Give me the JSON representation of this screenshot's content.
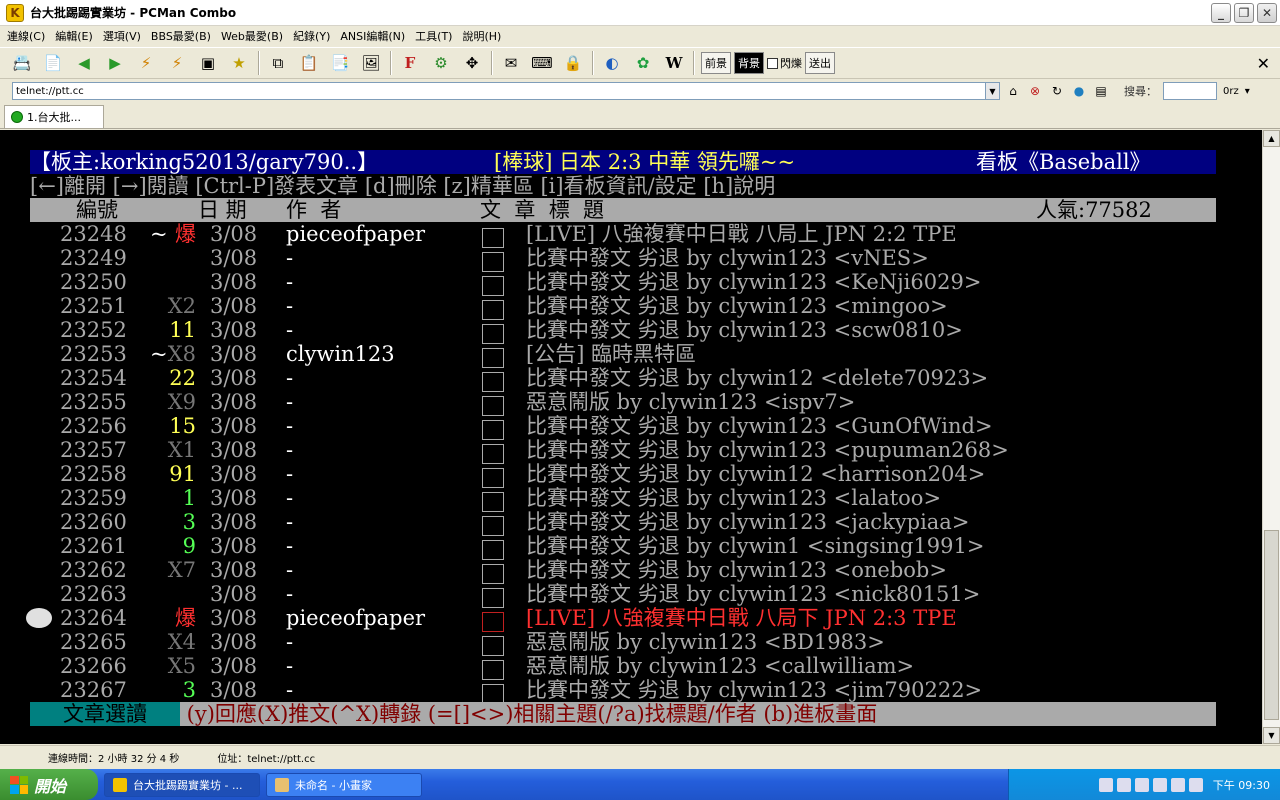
{
  "window": {
    "title": "台大批踢踢實業坊 - PCMan Combo",
    "app_icon": "K"
  },
  "menu": [
    "連線(C)",
    "編輯(E)",
    "選項(V)",
    "BBS最愛(B)",
    "Web最愛(B)",
    "紀錄(Y)",
    "ANSI編輯(N)",
    "工具(T)",
    "說明(H)"
  ],
  "toolbar": {
    "foreground_label": "前景",
    "background_label": "背景",
    "blink_label": "閃爍",
    "send_label": "送出"
  },
  "address": {
    "value": "telnet://ptt.cc",
    "search_label": "搜尋：",
    "search_mode": "0rz"
  },
  "tab": {
    "label": "1.台大批..."
  },
  "board": {
    "header_left": "【板主:korking52013/gary790..】",
    "header_mid": "[棒球] 日本 2:3 中華 領先囉~~",
    "header_right": "看板《Baseball》",
    "help_line": "[←]離開 [→]閱讀 [Ctrl-P]發表文章 [d]刪除 [z]精華區 [i]看板資訊/設定 [h]說明",
    "col_no": "編號",
    "col_date": "日 期",
    "col_author": "作  者",
    "col_title": "文  章  標  題",
    "popularity": "人氣:77582"
  },
  "posts": [
    {
      "no": "23248",
      "mark": "~",
      "score": "爆",
      "score_color": "red",
      "date": "3/08",
      "author": "pieceofpaper",
      "title": "[LIVE] 八強複賽中日戰 八局上 JPN 2:2 TPE",
      "title_color": "gray"
    },
    {
      "no": "23249",
      "mark": "",
      "score": "",
      "score_color": "gray",
      "date": "3/08",
      "author": "-",
      "title": "比賽中發文 劣退 by clywin123 <vNES>",
      "title_color": "gray"
    },
    {
      "no": "23250",
      "mark": "",
      "score": "",
      "score_color": "gray",
      "date": "3/08",
      "author": "-",
      "title": "比賽中發文 劣退 by clywin123 <KeNji6029>",
      "title_color": "gray"
    },
    {
      "no": "23251",
      "mark": "",
      "score": "X2",
      "score_color": "dimgray",
      "date": "3/08",
      "author": "-",
      "title": "比賽中發文 劣退 by clywin123 <mingoo>",
      "title_color": "gray"
    },
    {
      "no": "23252",
      "mark": "",
      "score": "11",
      "score_color": "yellow",
      "date": "3/08",
      "author": "-",
      "title": "比賽中發文 劣退 by clywin123 <scw0810>",
      "title_color": "gray"
    },
    {
      "no": "23253",
      "mark": "~",
      "score": "X8",
      "score_color": "dimgray",
      "date": "3/08",
      "author": "clywin123",
      "title": "[公告] 臨時黑特區",
      "title_color": "gray"
    },
    {
      "no": "23254",
      "mark": "",
      "score": "22",
      "score_color": "yellow",
      "date": "3/08",
      "author": "-",
      "title": "比賽中發文 劣退 by clywin12 <delete70923>",
      "title_color": "gray"
    },
    {
      "no": "23255",
      "mark": "",
      "score": "X9",
      "score_color": "dimgray",
      "date": "3/08",
      "author": "-",
      "title": "惡意鬧版 by clywin123 <ispv7>",
      "title_color": "gray"
    },
    {
      "no": "23256",
      "mark": "",
      "score": "15",
      "score_color": "yellow",
      "date": "3/08",
      "author": "-",
      "title": "比賽中發文 劣退 by clywin123 <GunOfWind>",
      "title_color": "gray"
    },
    {
      "no": "23257",
      "mark": "",
      "score": "X1",
      "score_color": "dimgray",
      "date": "3/08",
      "author": "-",
      "title": "比賽中發文 劣退 by clywin123 <pupuman268>",
      "title_color": "gray"
    },
    {
      "no": "23258",
      "mark": "",
      "score": "91",
      "score_color": "yellow",
      "date": "3/08",
      "author": "-",
      "title": "比賽中發文 劣退 by clywin12 <harrison204>",
      "title_color": "gray"
    },
    {
      "no": "23259",
      "mark": "",
      "score": "1",
      "score_color": "green",
      "date": "3/08",
      "author": "-",
      "title": "比賽中發文 劣退 by clywin123 <lalatoo>",
      "title_color": "gray"
    },
    {
      "no": "23260",
      "mark": "",
      "score": "3",
      "score_color": "green",
      "date": "3/08",
      "author": "-",
      "title": "比賽中發文 劣退 by clywin123 <jackypiaa>",
      "title_color": "gray"
    },
    {
      "no": "23261",
      "mark": "",
      "score": "9",
      "score_color": "green",
      "date": "3/08",
      "author": "-",
      "title": "比賽中發文 劣退 by clywin1 <singsing1991>",
      "title_color": "gray"
    },
    {
      "no": "23262",
      "mark": "",
      "score": "X7",
      "score_color": "dimgray",
      "date": "3/08",
      "author": "-",
      "title": "比賽中發文 劣退 by clywin123 <onebob>",
      "title_color": "gray"
    },
    {
      "no": "23263",
      "mark": "",
      "score": "",
      "score_color": "gray",
      "date": "3/08",
      "author": "-",
      "title": "比賽中發文 劣退 by clywin123 <nick80151>",
      "title_color": "gray"
    },
    {
      "no": "23264",
      "mark": "",
      "score": "爆",
      "score_color": "red",
      "date": "3/08",
      "author": "pieceofpaper",
      "title": "[LIVE] 八強複賽中日戰 八局下 JPN 2:3 TPE",
      "title_color": "red",
      "selected": true
    },
    {
      "no": "23265",
      "mark": "",
      "score": "X4",
      "score_color": "dimgray",
      "date": "3/08",
      "author": "-",
      "title": "惡意鬧版 by clywin123 <BD1983>",
      "title_color": "gray"
    },
    {
      "no": "23266",
      "mark": "",
      "score": "X5",
      "score_color": "dimgray",
      "date": "3/08",
      "author": "-",
      "title": "惡意鬧版 by clywin123 <callwilliam>",
      "title_color": "gray"
    },
    {
      "no": "23267",
      "mark": "",
      "score": "3",
      "score_color": "green",
      "date": "3/08",
      "author": "-",
      "title": "比賽中發文 劣退 by clywin123 <jim790222>",
      "title_color": "gray"
    }
  ],
  "footer": {
    "mode": "文章選讀",
    "keys": " (y)回應(X)推文(^X)轉錄 (=[]<>)相關主題(/?a)找標題/作者 (b)進板畫面"
  },
  "status": {
    "connected_time": "連線時間：2 小時 32 分 4 秒",
    "address": "位址：telnet://ptt.cc"
  },
  "taskbar": {
    "start_label": "開始",
    "tasks": [
      "台大批踢踢實業坊 - ...",
      "未命名 - 小畫家"
    ],
    "clock": "下午 09:30"
  },
  "colors": {
    "terminal_bg": "#000000",
    "header_bg": "#000080",
    "footer_mode_bg": "#008080",
    "column_header_bg": "#aaaaaa"
  }
}
